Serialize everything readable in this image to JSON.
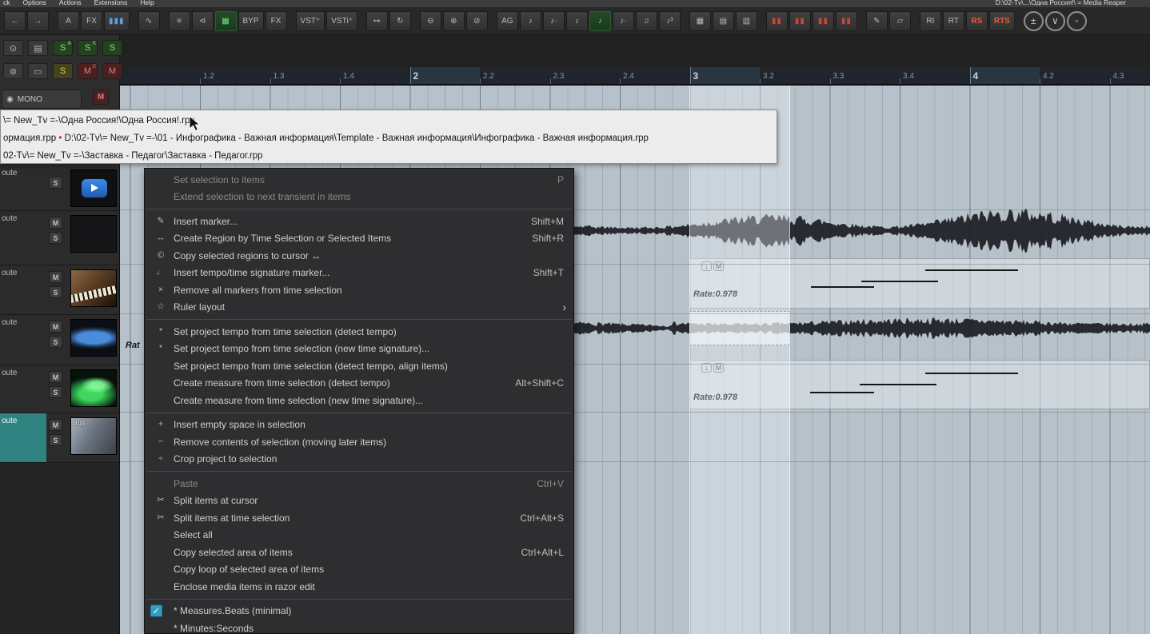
{
  "titlebar": {
    "menus": [
      "ck",
      "Options",
      "Actions",
      "Extensions",
      "Help"
    ],
    "title": "D:\\02-Tv\\...\\Одна Россия!\\ = Media Reaper"
  },
  "toolbar": {
    "groups": [
      {
        "buttons": [
          {
            "icon": "nav-back"
          },
          {
            "icon": "nav-forward"
          }
        ]
      },
      {
        "buttons": [
          {
            "label": "A"
          },
          {
            "label": "FX"
          },
          {
            "icon": "meter-bars"
          }
        ]
      },
      {
        "buttons": [
          {
            "icon": "envelope"
          }
        ]
      },
      {
        "buttons": [
          {
            "icon": "mixer"
          },
          {
            "icon": "speaker"
          },
          {
            "icon": "monitor",
            "active": true
          },
          {
            "label": "BYP"
          },
          {
            "label": "FX"
          }
        ]
      },
      {
        "buttons": [
          {
            "label": "VST⁺"
          },
          {
            "label": "VSTi⁺"
          }
        ]
      },
      {
        "buttons": [
          {
            "icon": "insert-plug"
          },
          {
            "icon": "sync"
          }
        ]
      },
      {
        "buttons": [
          {
            "icon": "zoom-out"
          },
          {
            "icon": "zoom-in"
          },
          {
            "icon": "zoom-q"
          }
        ]
      },
      {
        "buttons": [
          {
            "label": "AG"
          },
          {
            "icon": "note-quarter"
          },
          {
            "icon": "note-dotted"
          },
          {
            "icon": "note-eighth"
          },
          {
            "icon": "note-grid",
            "active": true
          },
          {
            "icon": "note-dotted2"
          },
          {
            "icon": "note-double"
          },
          {
            "icon": "note-triplet"
          }
        ]
      },
      {
        "buttons": [
          {
            "icon": "grid-dots-1"
          },
          {
            "icon": "grid-dots-2"
          },
          {
            "icon": "grid-dots-3"
          }
        ]
      },
      {
        "buttons": [
          {
            "icon": "fader-red-1"
          },
          {
            "icon": "fader-red-2"
          },
          {
            "icon": "fader-red-3"
          },
          {
            "icon": "fader-red-4"
          }
        ]
      },
      {
        "buttons": [
          {
            "icon": "pencil"
          },
          {
            "icon": "eraser"
          }
        ]
      },
      {
        "buttons": [
          {
            "label": "RI"
          },
          {
            "label": "RT"
          },
          {
            "label": "RS",
            "accent": true
          },
          {
            "label": "RTS",
            "accent": true
          }
        ]
      },
      {
        "buttons": [
          {
            "icon": "zoom-tool-1",
            "round": true
          },
          {
            "icon": "zoom-tool-2",
            "round": true
          },
          {
            "icon": "zoom-tool-3",
            "round": true
          }
        ]
      }
    ]
  },
  "left_panel": {
    "rows": [
      {
        "cells": [
          {
            "icon": "eye"
          },
          {
            "icon": "list"
          },
          {
            "label": "S",
            "sup": "A",
            "color": "green"
          },
          {
            "label": "S",
            "sup": "X",
            "color": "green"
          },
          {
            "label": "S",
            "color": "green"
          }
        ]
      },
      {
        "cells": [
          {
            "icon": "eye-zoom"
          },
          {
            "icon": "folder"
          },
          {
            "label": "S",
            "color": "yellow"
          },
          {
            "label": "M",
            "sup": "X",
            "color": "red"
          },
          {
            "label": "M",
            "color": "red"
          }
        ]
      }
    ],
    "mono_label": "MONO",
    "mono_mute": "M"
  },
  "ruler": {
    "ticks": [
      "1.2",
      "1.3",
      "1.4",
      "2",
      "2.2",
      "2.3",
      "2.4",
      "3",
      "3.2",
      "3.3",
      "3.4",
      "4",
      "4.2",
      "4.3"
    ]
  },
  "tooltip": {
    "lines": [
      [
        {
          "t": "\\= New_Tv =-\\Одна Россия!\\Одна Россия!.rpp"
        }
      ],
      [
        {
          "t": "ормация.rpp "
        },
        {
          "t": "•",
          "c": "#c22222"
        },
        {
          "t": " D:\\02-Tv\\= New_Tv =-\\01 - Инфографика - Важная информация\\Template - Важная информация\\Инфографика - Важная информация.rpp"
        }
      ],
      [
        {
          "t": "02-Tv\\= New_Tv =-\\Заставка - Педагог\\Заставка - Педагог.rpp"
        }
      ]
    ]
  },
  "context_menu": {
    "items": [
      {
        "label": "Set selection to items",
        "shortcut": "P",
        "disabled": true
      },
      {
        "label": "Extend selection to next transient in items",
        "disabled": true
      },
      {
        "separator": true
      },
      {
        "icon": "pencil",
        "label": "Insert marker...",
        "shortcut": "Shift+M"
      },
      {
        "icon": "arrows-lr",
        "label": "Create Region by Time Selection or Selected Items",
        "shortcut": "Shift+R"
      },
      {
        "icon": "copy",
        "label": "Copy selected regions to cursor ↔"
      },
      {
        "icon": "tempo",
        "label": "Insert tempo/time signature marker...",
        "shortcut": "Shift+T"
      },
      {
        "icon": "remove",
        "label": "Remove all markers from time selection"
      },
      {
        "icon": "star",
        "label": "Ruler layout",
        "submenu": true
      },
      {
        "separator": true
      },
      {
        "icon": "asterisk",
        "label": "Set project tempo from time selection (detect tempo)"
      },
      {
        "icon": "asterisk",
        "label": "Set project tempo from time selection (new time signature)..."
      },
      {
        "label": "Set project tempo from time selection (detect tempo, align items)"
      },
      {
        "label": "Create measure from time selection (detect tempo)",
        "shortcut": "Alt+Shift+C"
      },
      {
        "label": "Create measure from time selection (new time signature)..."
      },
      {
        "separator": true
      },
      {
        "icon": "plus",
        "label": "Insert empty space in selection"
      },
      {
        "icon": "minus",
        "label": "Remove contents of selection (moving later items)"
      },
      {
        "icon": "divide",
        "label": "Crop project to selection"
      },
      {
        "separator": true
      },
      {
        "label": "Paste",
        "shortcut": "Ctrl+V",
        "disabled": true
      },
      {
        "icon": "scissors",
        "label": "Split items at cursor"
      },
      {
        "icon": "scissors",
        "label": "Split items at time selection",
        "shortcut": "Ctrl+Alt+S"
      },
      {
        "label": "Select all"
      },
      {
        "label": "Copy selected area of items",
        "shortcut": "Ctrl+Alt+L"
      },
      {
        "label": "Copy loop of selected area of items"
      },
      {
        "label": "Enclose media items in razor edit"
      },
      {
        "separator": true
      },
      {
        "label": "* Measures.Beats (minimal)",
        "checked": true
      },
      {
        "label": "* Minutes:Seconds"
      }
    ]
  },
  "tracks": [
    {
      "route": "oute",
      "buttons": [
        {
          "label": "S"
        }
      ],
      "thumb": "play-logo"
    },
    {
      "route": "oute",
      "buttons": [
        {
          "label": "M"
        },
        {
          "label": "S"
        }
      ],
      "thumb": "none"
    },
    {
      "route": "oute",
      "buttons": [
        {
          "label": "M"
        },
        {
          "label": "S"
        }
      ],
      "thumb": "piano"
    },
    {
      "route": "oute",
      "buttons": [
        {
          "label": "M"
        },
        {
          "label": "S"
        }
      ],
      "thumb": "waveform"
    },
    {
      "route": "oute",
      "buttons": [
        {
          "label": "M"
        },
        {
          "label": "S"
        }
      ],
      "thumb": "spectrum"
    },
    {
      "route": "oute",
      "buttons": [
        {
          "label": "M"
        },
        {
          "label": "S"
        }
      ],
      "thumb": "mixer",
      "label": "Bus",
      "selected": true
    }
  ],
  "arrange": {
    "item_rate_label_1": "Rate:0.978",
    "item_rate_label_2": "Rate:0.978",
    "partial_rate_label": "Rat",
    "badge_arrow": "↓",
    "badge_mute": "M"
  }
}
